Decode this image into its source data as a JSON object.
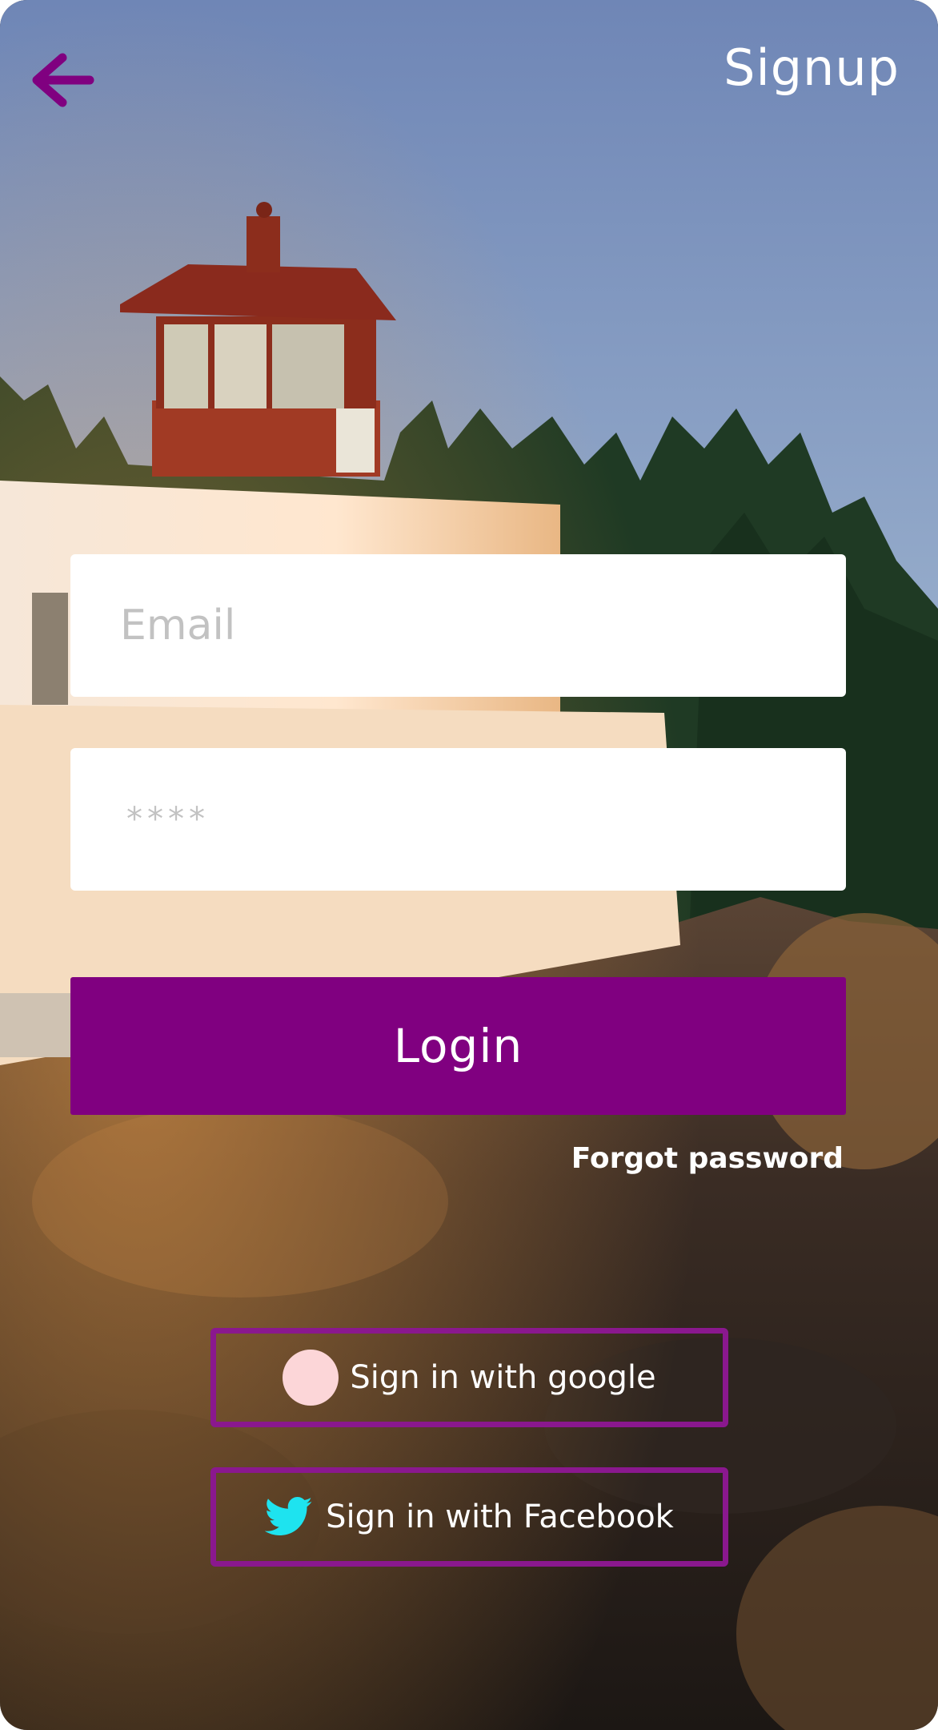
{
  "header": {
    "back_icon": "arrow-left-icon",
    "signup_label": "Signup"
  },
  "form": {
    "email_placeholder": "Email",
    "email_value": "",
    "password_placeholder": "****",
    "password_value": "",
    "login_label": "Login",
    "forgot_label": "Forgot password"
  },
  "social": {
    "google_label": "Sign in with google",
    "google_icon": "google-icon",
    "facebook_label": "Sign in with Facebook",
    "facebook_icon": "twitter-bird-icon"
  },
  "colors": {
    "accent": "#800080",
    "social_border": "#8a188e",
    "google_icon_fill": "#fcd6d8",
    "twitter_icon_fill": "#1ee3ef",
    "text_light": "#ffffff",
    "placeholder": "#c2c2c2"
  }
}
